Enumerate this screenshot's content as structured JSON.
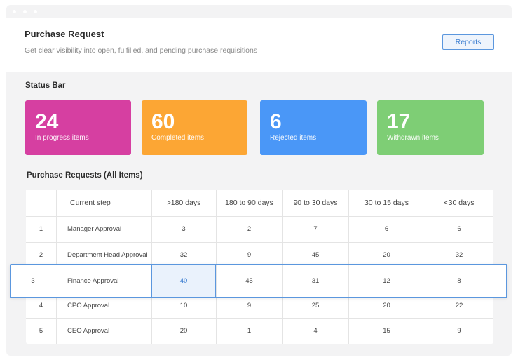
{
  "header": {
    "title": "Purchase Request",
    "subtitle": "Get clear visibility into open, fulfilled, and pending purchase requisitions",
    "reports_label": "Reports"
  },
  "status_bar": {
    "title": "Status Bar",
    "cards": [
      {
        "value": "24",
        "label": "In progress items",
        "color": "#d63fa1"
      },
      {
        "value": "60",
        "label": "Completed items",
        "color": "#fca634"
      },
      {
        "value": "6",
        "label": "Rejected items",
        "color": "#4a97f7"
      },
      {
        "value": "17",
        "label": "Withdrawn items",
        "color": "#7ece75"
      }
    ]
  },
  "table": {
    "title": "Purchase Requests (All Items)",
    "columns": [
      "",
      "Current step",
      ">180 days",
      "180 to 90 days",
      "90 to 30 days",
      "30 to 15 days",
      "<30 days"
    ],
    "rows": [
      {
        "num": "1",
        "step": "Manager Approval",
        "values": [
          "3",
          "2",
          "7",
          "6",
          "6"
        ]
      },
      {
        "num": "2",
        "step": "Department Head Approval",
        "values": [
          "32",
          "9",
          "45",
          "20",
          "32"
        ]
      },
      {
        "num": "3",
        "step": "Finance Approval",
        "values": [
          "40",
          "45",
          "31",
          "12",
          "8"
        ]
      },
      {
        "num": "4",
        "step": "CPO Approval",
        "values": [
          "10",
          "9",
          "25",
          "20",
          "22"
        ]
      },
      {
        "num": "5",
        "step": "CEO Approval",
        "values": [
          "20",
          "1",
          "4",
          "15",
          "9"
        ]
      }
    ],
    "selected_row": 2,
    "highlight_color": "#3d7fd1"
  }
}
